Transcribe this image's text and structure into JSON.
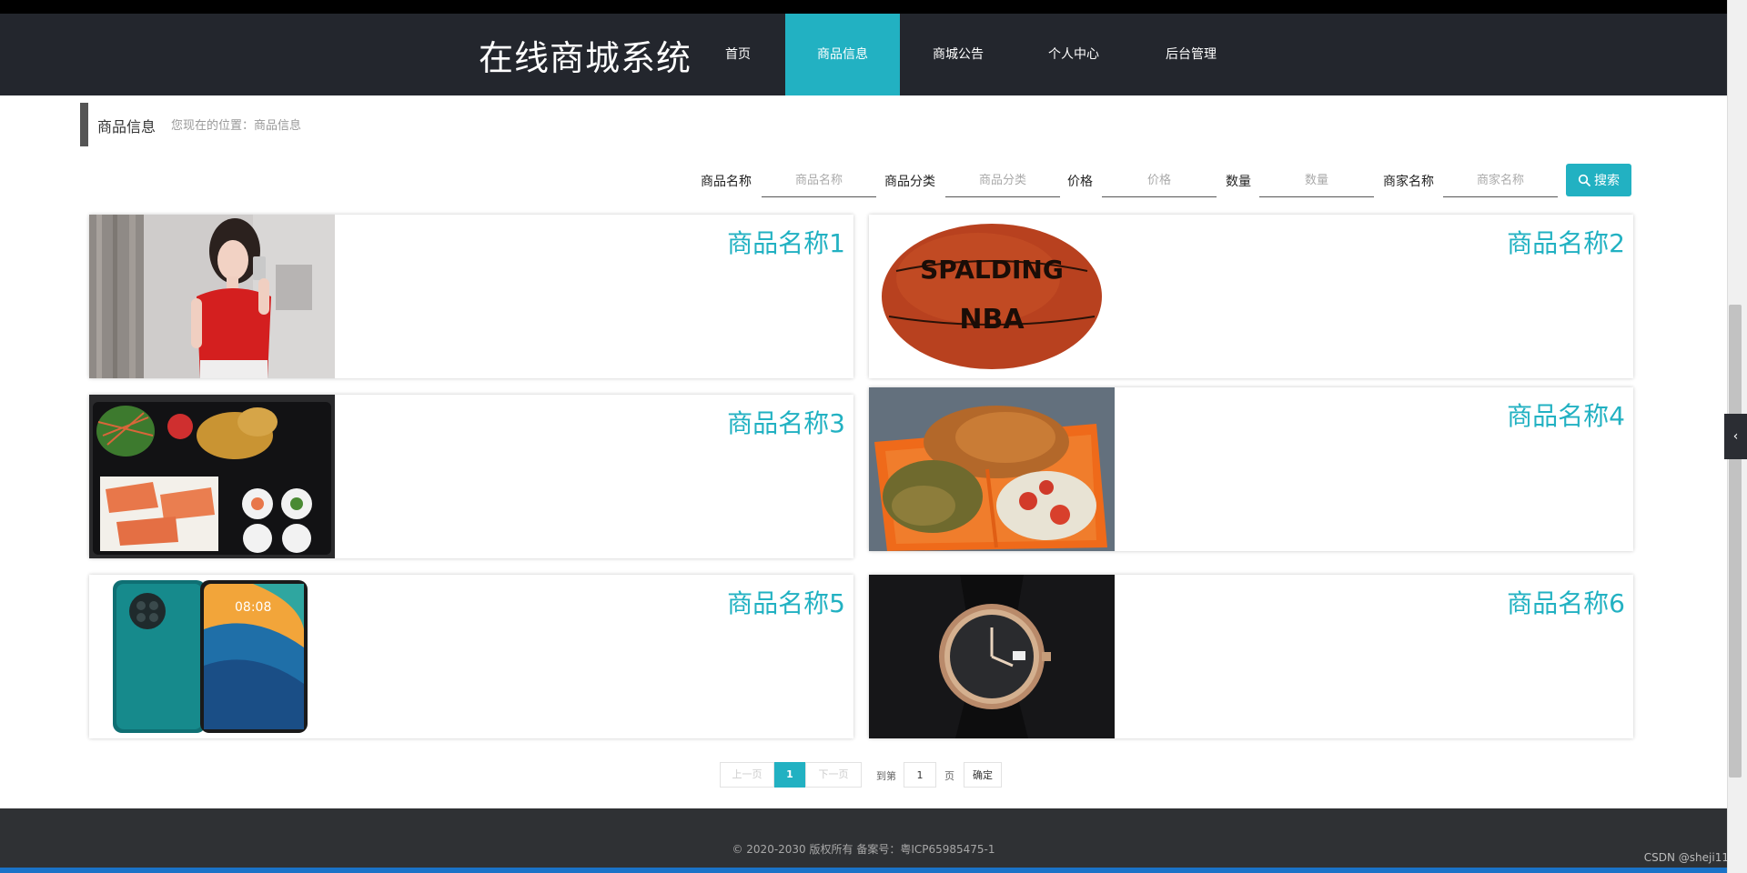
{
  "header": {
    "title": "在线商城系统",
    "nav": [
      {
        "label": "首页"
      },
      {
        "label": "商品信息"
      },
      {
        "label": "商城公告"
      },
      {
        "label": "个人中心"
      },
      {
        "label": "后台管理"
      }
    ]
  },
  "breadcrumb": {
    "title": "商品信息",
    "location": "您现在的位置：商品信息"
  },
  "search": {
    "fields": [
      {
        "label": "商品名称",
        "placeholder": "商品名称"
      },
      {
        "label": "商品分类",
        "placeholder": "商品分类"
      },
      {
        "label": "价格",
        "placeholder": "价格"
      },
      {
        "label": "数量",
        "placeholder": "数量"
      },
      {
        "label": "商家名称",
        "placeholder": "商家名称"
      }
    ],
    "button": "搜索"
  },
  "products": [
    {
      "name": "商品名称1"
    },
    {
      "name": "商品名称2"
    },
    {
      "name": "商品名称3"
    },
    {
      "name": "商品名称4"
    },
    {
      "name": "商品名称5"
    },
    {
      "name": "商品名称6"
    }
  ],
  "pagination": {
    "prev": "上一页",
    "current": "1",
    "next": "下一页",
    "goto": "到第",
    "page_value": "1",
    "page_unit": "页",
    "confirm": "确定"
  },
  "footer": {
    "text": "© 2020-2030 版权所有 备案号：粤ICP65985475-1"
  },
  "watermark": "CSDN @sheji11",
  "colors": {
    "accent": "#22b1c2",
    "nav_bg": "#23262d",
    "footer_bg": "#2f3134"
  }
}
